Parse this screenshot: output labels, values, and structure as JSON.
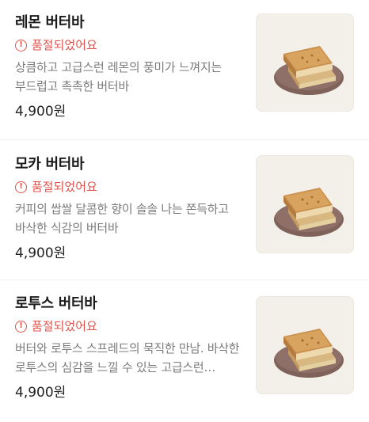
{
  "menu": {
    "items": [
      {
        "name": "레몬 버터바",
        "status": "품절되었어요",
        "description": "상큼하고 고급스런 레몬의 풍미가 느껴지는 부드럽고 촉촉한 버터바",
        "price": "4,900원",
        "image_icon": "butter-bar-photo"
      },
      {
        "name": "모카 버터바",
        "status": "품절되었어요",
        "description": "커피의 쌉쌀 달콤한 향이 솔솔 나는 쫀득하고 바삭한 식감의 버터바",
        "price": "4,900원",
        "image_icon": "butter-bar-photo"
      },
      {
        "name": "로투스 버터바",
        "status": "품절되었어요",
        "description": "버터와 로투스 스프레드의 묵직한 만남. 바삭한 로투스의 심감을 느낄 수 있는 고급스런…",
        "price": "4,900원",
        "image_icon": "butter-bar-photo"
      }
    ]
  },
  "colors": {
    "soldout": "#e0524b",
    "plate": "#8a6a62",
    "thumb_bg": "#f3efe9"
  }
}
